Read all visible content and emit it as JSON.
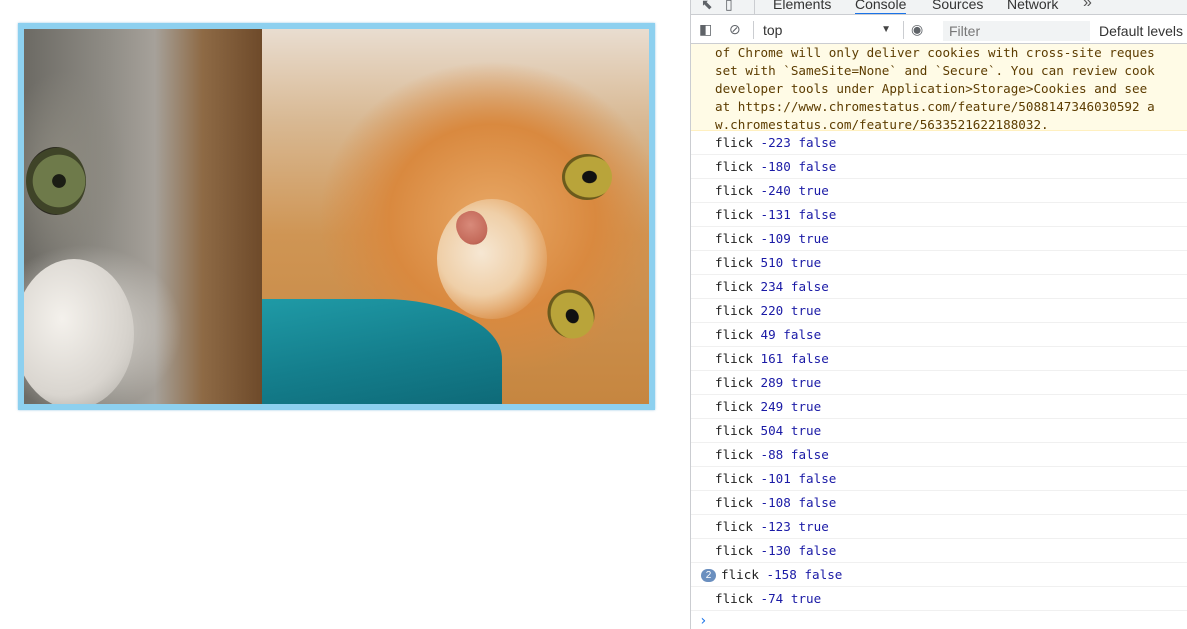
{
  "devtools": {
    "tabs": [
      {
        "label": "Elements"
      },
      {
        "label": "Console"
      },
      {
        "label": "Sources"
      },
      {
        "label": "Network"
      }
    ],
    "more_tabs_glyph": "»",
    "toolbar": {
      "context": "top",
      "filter_placeholder": "Filter",
      "levels_label": "Default levels"
    },
    "warning_lines": [
      "of Chrome will only deliver cookies with cross-site reques",
      "set with `SameSite=None` and `Secure`. You can review cook",
      "developer tools under Application>Storage>Cookies and see",
      "at https://www.chromestatus.com/feature/5088147346030592 a",
      "w.chromestatus.com/feature/5633521622188032."
    ],
    "log_rows": [
      {
        "label": "flick",
        "value": "-223",
        "flag": "false"
      },
      {
        "label": "flick",
        "value": "-180",
        "flag": "false"
      },
      {
        "label": "flick",
        "value": "-240",
        "flag": "true"
      },
      {
        "label": "flick",
        "value": "-131",
        "flag": "false"
      },
      {
        "label": "flick",
        "value": "-109",
        "flag": "true"
      },
      {
        "label": "flick",
        "value": "510",
        "flag": "true"
      },
      {
        "label": "flick",
        "value": "234",
        "flag": "false"
      },
      {
        "label": "flick",
        "value": "220",
        "flag": "true"
      },
      {
        "label": "flick",
        "value": "49",
        "flag": "false"
      },
      {
        "label": "flick",
        "value": "161",
        "flag": "false"
      },
      {
        "label": "flick",
        "value": "289",
        "flag": "true"
      },
      {
        "label": "flick",
        "value": "249",
        "flag": "true"
      },
      {
        "label": "flick",
        "value": "504",
        "flag": "true"
      },
      {
        "label": "flick",
        "value": "-88",
        "flag": "false"
      },
      {
        "label": "flick",
        "value": "-101",
        "flag": "false"
      },
      {
        "label": "flick",
        "value": "-108",
        "flag": "false"
      },
      {
        "label": "flick",
        "value": "-123",
        "flag": "true"
      },
      {
        "label": "flick",
        "value": "-130",
        "flag": "false"
      },
      {
        "label": "flick",
        "value": "-158",
        "flag": "false",
        "repeat": "2"
      },
      {
        "label": "flick",
        "value": "-74",
        "flag": "true"
      }
    ],
    "prompt_glyph": "›"
  },
  "colors": {
    "carousel_border": "#8dd0ef",
    "active_tab_underline": "#1a73e8",
    "warning_bg": "#fffbe6",
    "value_color": "#1a1aa6"
  }
}
